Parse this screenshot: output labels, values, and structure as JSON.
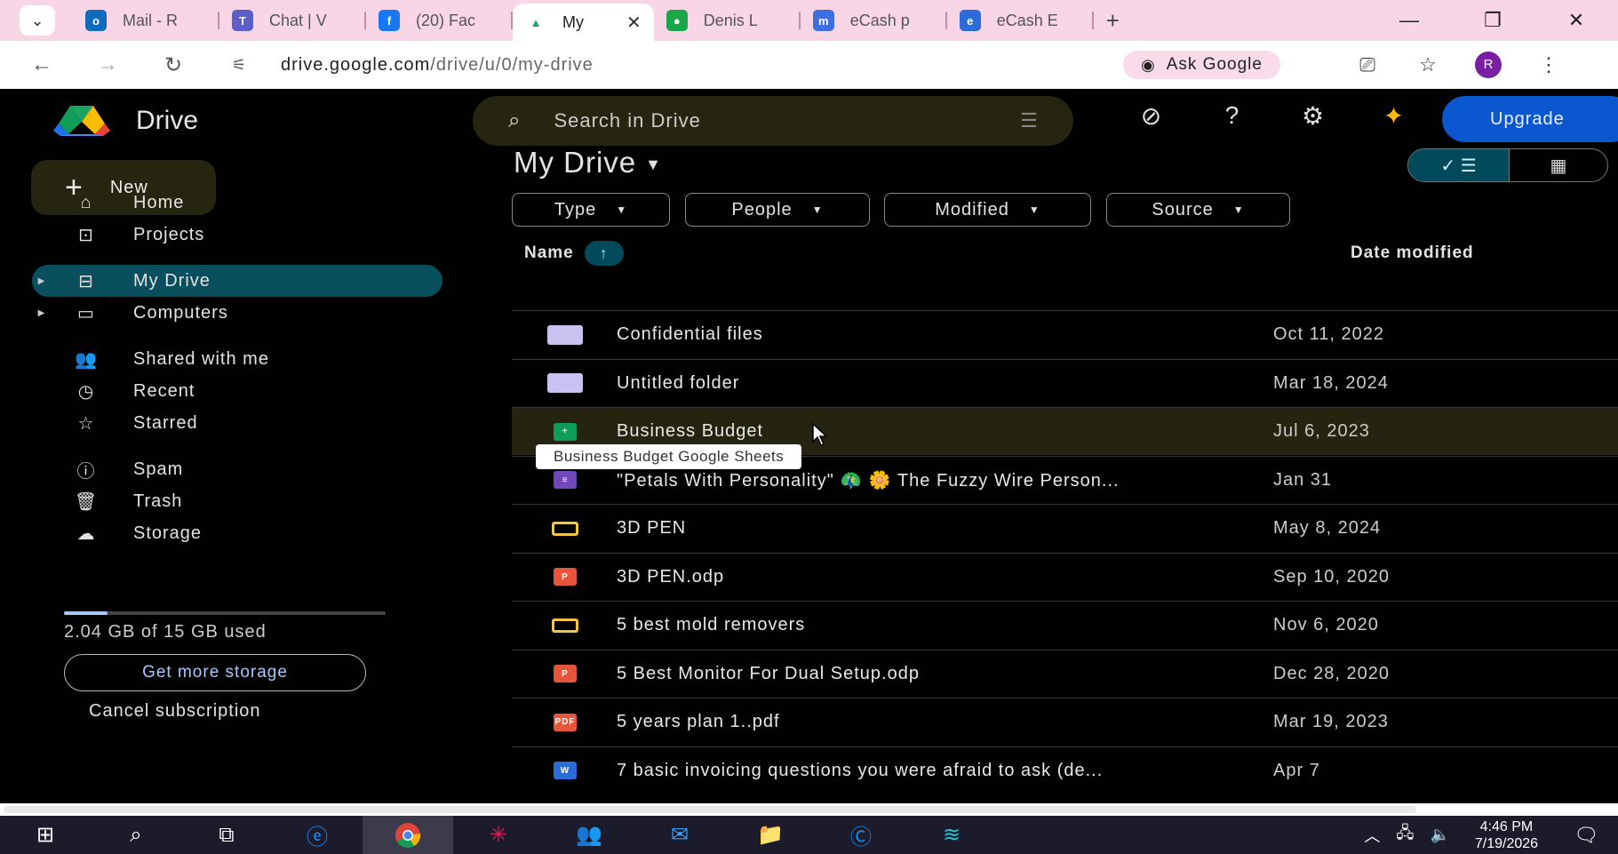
{
  "browser": {
    "tabs": [
      {
        "title": "Mail - R",
        "icon": "outlook-icon",
        "color": "#0f6cbd"
      },
      {
        "title": "Chat | V",
        "icon": "teams-icon",
        "color": "#5b5fc7"
      },
      {
        "title": "(20) Fac",
        "icon": "facebook-icon",
        "color": "#1877f2"
      },
      {
        "title": "My",
        "icon": "drive-icon",
        "color": "#ffffff",
        "active": true
      },
      {
        "title": "Denis L",
        "icon": "chat-icon",
        "color": "#1aa64a"
      },
      {
        "title": "eCash p",
        "icon": "messenger-icon",
        "color": "#3c6fe0"
      },
      {
        "title": "eCash E",
        "icon": "ecash-icon",
        "color": "#2b6cd9"
      }
    ],
    "url_host": "drive.google.com",
    "url_path": "/drive/u/0/my-drive",
    "ask_google": "Ask Google",
    "profile_initial": "R"
  },
  "drive": {
    "app_name": "Drive",
    "search_placeholder": "Search in Drive",
    "upgrade_label": "Upgrade",
    "new_label": "New",
    "nav": [
      {
        "label": "Home",
        "icon": "home-icon"
      },
      {
        "label": "Projects",
        "icon": "projects-icon"
      },
      {
        "label": "My Drive",
        "icon": "my-drive-icon",
        "active": true
      },
      {
        "label": "Computers",
        "icon": "computers-icon"
      },
      {
        "label": "Shared with me",
        "icon": "shared-icon"
      },
      {
        "label": "Recent",
        "icon": "clock-icon"
      },
      {
        "label": "Starred",
        "icon": "star-icon"
      },
      {
        "label": "Spam",
        "icon": "spam-icon"
      },
      {
        "label": "Trash",
        "icon": "trash-icon"
      },
      {
        "label": "Storage",
        "icon": "cloud-icon"
      }
    ],
    "storage_used_fraction": 0.136,
    "storage_text": "2.04 GB of 15 GB used",
    "get_more_storage": "Get more storage",
    "cancel_subscription": "Cancel subscription",
    "page_title": "My Drive",
    "filters": [
      "Type",
      "People",
      "Modified",
      "Source"
    ],
    "columns": {
      "name": "Name",
      "date": "Date modified"
    },
    "files": [
      {
        "name": "Confidential files",
        "date": "Oct 11, 2022",
        "type": "folder"
      },
      {
        "name": "Untitled folder",
        "date": "Mar 18, 2024",
        "type": "folder"
      },
      {
        "name": "Business Budget",
        "date": "Jul 6, 2023",
        "type": "sheets",
        "selected": true
      },
      {
        "name": "\"Petals With Personality\" 🦚 🌼 The Fuzzy Wire Person...",
        "date": "Jan 31",
        "type": "forms"
      },
      {
        "name": "3D PEN",
        "date": "May 8, 2024",
        "type": "slides"
      },
      {
        "name": "3D PEN.odp",
        "date": "Sep 10, 2020",
        "type": "odp"
      },
      {
        "name": "5 best mold removers",
        "date": "Nov 6, 2020",
        "type": "slides"
      },
      {
        "name": "5 Best Monitor For Dual Setup.odp",
        "date": "Dec 28, 2020",
        "type": "odp"
      },
      {
        "name": "5 years plan 1..pdf",
        "date": "Mar 19, 2023",
        "type": "pdf"
      },
      {
        "name": "7 basic invoicing questions you were afraid to ask (de...",
        "date": "Apr 7",
        "type": "word"
      }
    ],
    "tooltip": "Business Budget Google Sheets"
  },
  "taskbar": {
    "time": "4:46 PM",
    "date": "7/19/2026"
  }
}
